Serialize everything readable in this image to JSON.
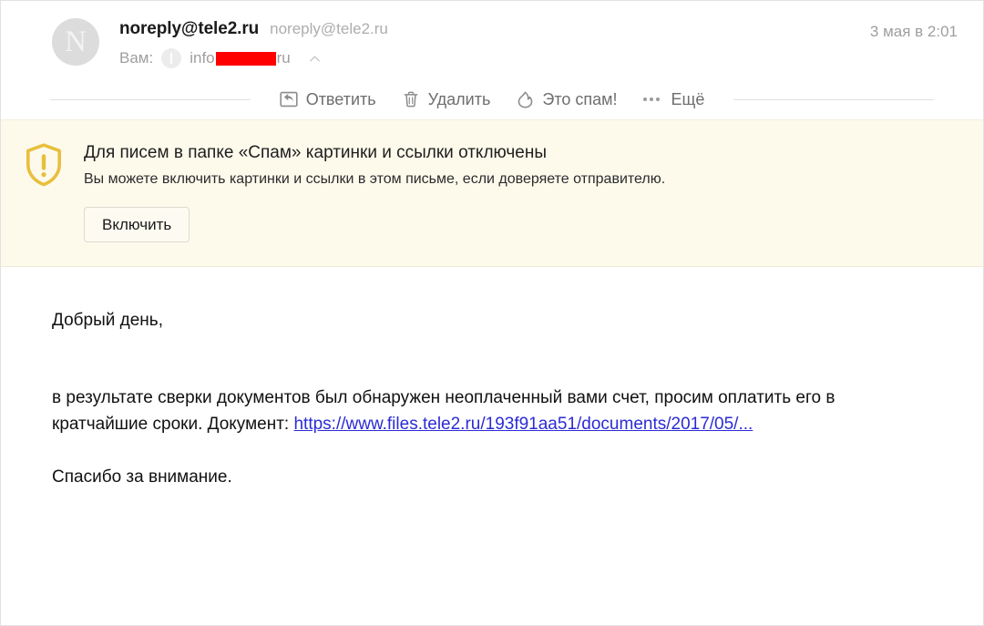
{
  "header": {
    "avatar_initial": "N",
    "sender_name": "noreply@tele2.ru",
    "sender_email": "noreply@tele2.ru",
    "timestamp": "3 мая в 2:01",
    "recipient_label": "Вам:",
    "recipient_prefix": "info",
    "recipient_suffix": "ru",
    "recipient_redacted": true
  },
  "toolbar": {
    "reply_label": "Ответить",
    "delete_label": "Удалить",
    "spam_label": "Это спам!",
    "more_label": "Ещё"
  },
  "banner": {
    "title": "Для писем в папке «Спам» картинки и ссылки отключены",
    "subtitle": "Вы можете включить картинки и ссылки в этом письме, если доверяете отправителю.",
    "button_label": "Включить",
    "background_color": "#FDFAEC",
    "icon_color": "#E8BF3D"
  },
  "body": {
    "greeting": "Добрый день,",
    "paragraph_before_link": "в результате сверки документов был обнаружен неоплаченный вами счет, просим оплатить его в кратчайшие сроки. Документ: ",
    "link_text": "https://www.files.tele2.ru/193f91aa51/documents/2017/05/...",
    "closing": "Спасибо за внимание.",
    "link_color": "#2B2BD6"
  }
}
